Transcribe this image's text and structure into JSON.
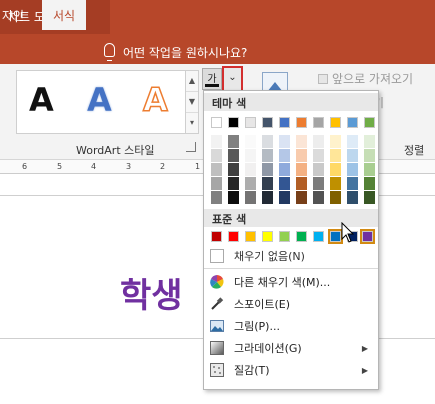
{
  "window": {
    "context_tab": "차트 도구"
  },
  "ribbon_tabs": [
    {
      "label": "자인"
    },
    {
      "label": "서식",
      "active": true
    }
  ],
  "tell_me": {
    "text": "어떤 작업을 원하시나요?"
  },
  "wordart": {
    "group_label": "WordArt 스타일",
    "sample_glyph": "A"
  },
  "fill_button": {
    "glyph": "가",
    "arrow": "⌄"
  },
  "arrange": {
    "bring_forward": "앞으로 가져오기",
    "send_backward": "내기",
    "align_label": "정렬"
  },
  "ruler": {
    "ticks": [
      "6",
      "5",
      "4",
      "3",
      "2",
      "1"
    ]
  },
  "slide": {
    "text": "학생"
  },
  "fill_menu": {
    "theme_header": "테마 색",
    "standard_header": "표준 색",
    "theme_colors": [
      "#ffffff",
      "#000000",
      "#e7e6e6",
      "#44546a",
      "#4472c4",
      "#ed7d31",
      "#a5a5a5",
      "#ffc000",
      "#5b9bd5",
      "#70ad47"
    ],
    "standard_colors": [
      "#c00000",
      "#ff0000",
      "#ffc000",
      "#ffff00",
      "#92d050",
      "#00b050",
      "#00b0f0",
      "#0070c0",
      "#002060",
      "#7030a0"
    ],
    "no_fill": "채우기 없음(N)",
    "more_colors": "다른 채우기 색(M)...",
    "eyedropper": "스포이트(E)",
    "picture": "그림(P)...",
    "gradient": "그라데이션(G)",
    "texture": "질감(T)"
  }
}
